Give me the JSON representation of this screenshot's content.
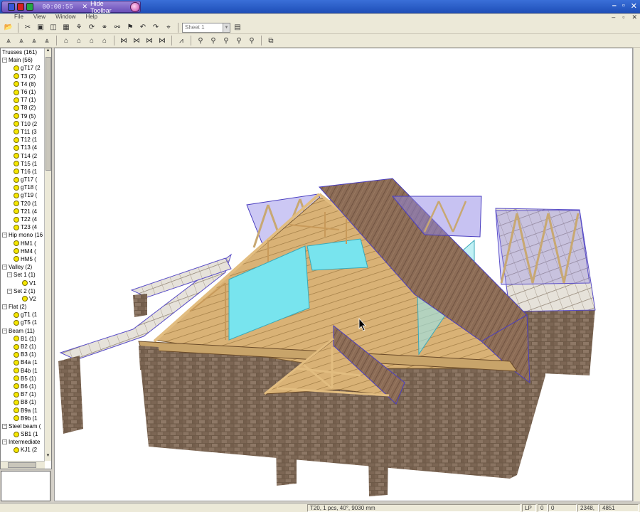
{
  "recorder": {
    "time": "00:00:55",
    "hide_label": "Hide Toolbar",
    "hide_x": "✕"
  },
  "window_controls": {
    "minimize": "–",
    "restore": "▫",
    "close": "✕"
  },
  "menu": {
    "items": [
      "File",
      "View",
      "Window",
      "Help"
    ]
  },
  "toolbar": {
    "sheet_select": "Sheet 1"
  },
  "tree": {
    "rows": [
      {
        "level": 0,
        "exp": "",
        "dot": false,
        "label": "Trusses (161)"
      },
      {
        "level": 0,
        "exp": "−",
        "dot": false,
        "label": "Main (56)"
      },
      {
        "level": 2,
        "exp": "",
        "dot": true,
        "label": "gT17 (2"
      },
      {
        "level": 2,
        "exp": "",
        "dot": true,
        "label": "T3 (2)"
      },
      {
        "level": 2,
        "exp": "",
        "dot": true,
        "label": "T4 (8)"
      },
      {
        "level": 2,
        "exp": "",
        "dot": true,
        "label": "T6 (1)"
      },
      {
        "level": 2,
        "exp": "",
        "dot": true,
        "label": "T7 (1)"
      },
      {
        "level": 2,
        "exp": "",
        "dot": true,
        "label": "T8 (2)"
      },
      {
        "level": 2,
        "exp": "",
        "dot": true,
        "label": "T9 (5)"
      },
      {
        "level": 2,
        "exp": "",
        "dot": true,
        "label": "T10 (2"
      },
      {
        "level": 2,
        "exp": "",
        "dot": true,
        "label": "T11 (3"
      },
      {
        "level": 2,
        "exp": "",
        "dot": true,
        "label": "T12 (1"
      },
      {
        "level": 2,
        "exp": "",
        "dot": true,
        "label": "T13 (4"
      },
      {
        "level": 2,
        "exp": "",
        "dot": true,
        "label": "T14 (2"
      },
      {
        "level": 2,
        "exp": "",
        "dot": true,
        "label": "T15 (1"
      },
      {
        "level": 2,
        "exp": "",
        "dot": true,
        "label": "T16 (1"
      },
      {
        "level": 2,
        "exp": "",
        "dot": true,
        "label": "gT17 ("
      },
      {
        "level": 2,
        "exp": "",
        "dot": true,
        "label": "gT18 ("
      },
      {
        "level": 2,
        "exp": "",
        "dot": true,
        "label": "gT19 ("
      },
      {
        "level": 2,
        "exp": "",
        "dot": true,
        "label": "T20 (1"
      },
      {
        "level": 2,
        "exp": "",
        "dot": true,
        "label": "T21 (4"
      },
      {
        "level": 2,
        "exp": "",
        "dot": true,
        "label": "T22 (4"
      },
      {
        "level": 2,
        "exp": "",
        "dot": true,
        "label": "T23 (4"
      },
      {
        "level": 0,
        "exp": "−",
        "dot": false,
        "label": "Hip mono (16"
      },
      {
        "level": 2,
        "exp": "",
        "dot": true,
        "label": "HM1 ("
      },
      {
        "level": 2,
        "exp": "",
        "dot": true,
        "label": "HM4 ("
      },
      {
        "level": 2,
        "exp": "",
        "dot": true,
        "label": "HM5 ("
      },
      {
        "level": 0,
        "exp": "−",
        "dot": false,
        "label": "Valley (2)"
      },
      {
        "level": 1,
        "exp": "−",
        "dot": false,
        "label": "Set 1 (1)"
      },
      {
        "level": 3,
        "exp": "",
        "dot": true,
        "label": "V1"
      },
      {
        "level": 1,
        "exp": "−",
        "dot": false,
        "label": "Set 2 (1)"
      },
      {
        "level": 3,
        "exp": "",
        "dot": true,
        "label": "V2"
      },
      {
        "level": 0,
        "exp": "−",
        "dot": false,
        "label": "Flat (2)"
      },
      {
        "level": 2,
        "exp": "",
        "dot": true,
        "label": "gT1 (1"
      },
      {
        "level": 2,
        "exp": "",
        "dot": true,
        "label": "gT5 (1"
      },
      {
        "level": 0,
        "exp": "−",
        "dot": false,
        "label": "Beam (11)"
      },
      {
        "level": 2,
        "exp": "",
        "dot": true,
        "label": "B1 (1)"
      },
      {
        "level": 2,
        "exp": "",
        "dot": true,
        "label": "B2 (1)"
      },
      {
        "level": 2,
        "exp": "",
        "dot": true,
        "label": "B3 (1)"
      },
      {
        "level": 2,
        "exp": "",
        "dot": true,
        "label": "B4a (1"
      },
      {
        "level": 2,
        "exp": "",
        "dot": true,
        "label": "B4b (1"
      },
      {
        "level": 2,
        "exp": "",
        "dot": true,
        "label": "B5 (1)"
      },
      {
        "level": 2,
        "exp": "",
        "dot": true,
        "label": "B6 (1)"
      },
      {
        "level": 2,
        "exp": "",
        "dot": true,
        "label": "B7 (1)"
      },
      {
        "level": 2,
        "exp": "",
        "dot": true,
        "label": "B8 (1)"
      },
      {
        "level": 2,
        "exp": "",
        "dot": true,
        "label": "B9a (1"
      },
      {
        "level": 2,
        "exp": "",
        "dot": true,
        "label": "B9b (1"
      },
      {
        "level": 0,
        "exp": "−",
        "dot": false,
        "label": "Steel beam ("
      },
      {
        "level": 2,
        "exp": "",
        "dot": true,
        "label": "SB1 (1"
      },
      {
        "level": 0,
        "exp": "−",
        "dot": false,
        "label": "Intermediate"
      },
      {
        "level": 2,
        "exp": "",
        "dot": true,
        "label": "KJ1 (2"
      }
    ]
  },
  "status": {
    "selection": "T20, 1 pcs, 40°, 9030 mm",
    "mode": "LP",
    "a": "0",
    "b": "0",
    "coord_x": "2348,",
    "coord_y": "4851"
  },
  "colors": {
    "brick": "#6e5a48",
    "roof": "#8a6a52",
    "timber": "#d9b276",
    "membrane": "#78e4ee",
    "gable": "#8f86e6"
  },
  "icons": {
    "toolbar1": [
      "open-icon",
      "cut-icon",
      "print-icon",
      "preview-icon",
      "grid-icon",
      "rotate-icon",
      "link-icon",
      "unlink-icon",
      "flag-icon",
      "undo-icon",
      "redo-icon",
      "snap-icon",
      "sheet-icon"
    ],
    "toolbar2": [
      "view-icon"
    ]
  }
}
